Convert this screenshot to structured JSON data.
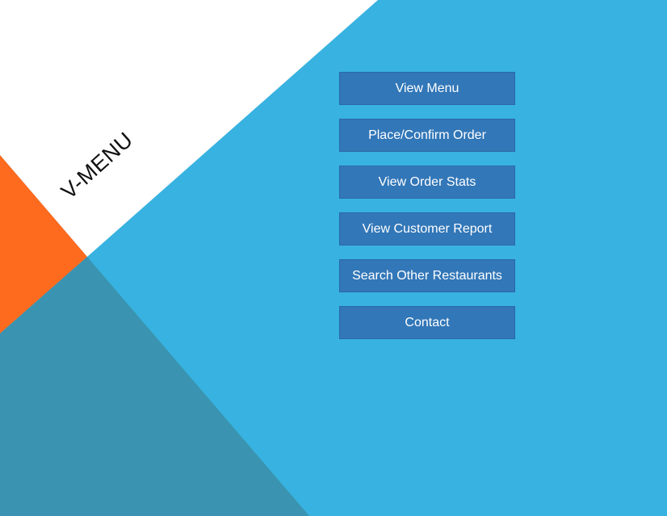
{
  "app": {
    "logo_text": "V-MENU"
  },
  "menu": {
    "items": [
      {
        "label": "View Menu"
      },
      {
        "label": "Place/Confirm Order"
      },
      {
        "label": "View Order Stats"
      },
      {
        "label": "View Customer Report"
      },
      {
        "label": "Search Other Restaurants"
      },
      {
        "label": "Contact"
      }
    ]
  },
  "colors": {
    "background_blue": "#38b2e0",
    "white_panel": "#ffffff",
    "orange_accent": "#fe6b1f",
    "dark_teal": "#3a94b1",
    "button_blue": "#3277b8",
    "button_text": "#ffffff"
  }
}
